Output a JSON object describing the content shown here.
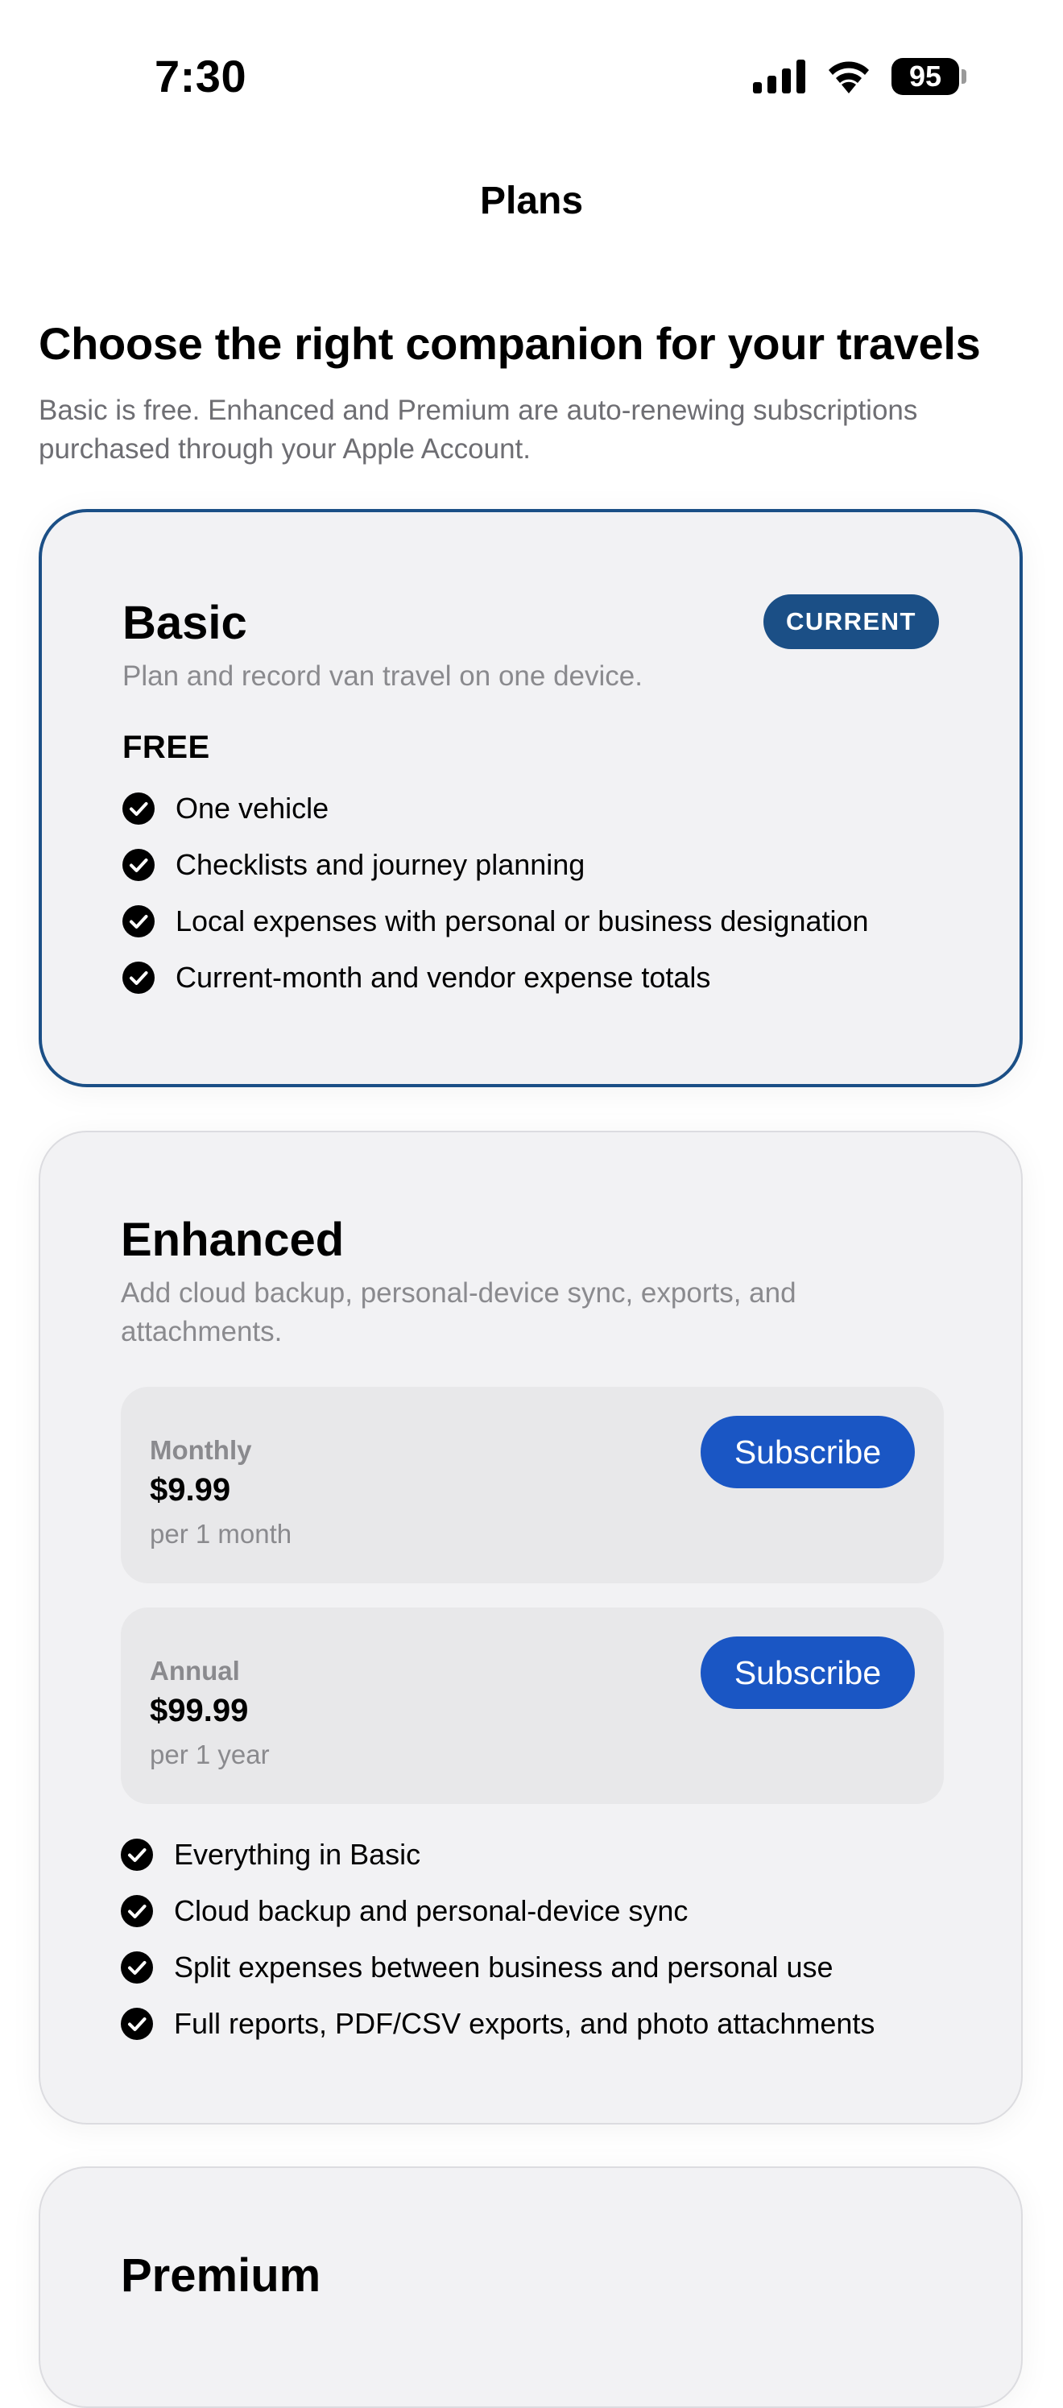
{
  "status_bar": {
    "time": "7:30",
    "battery": "95",
    "icons": [
      "cellular-signal-icon",
      "wifi-icon",
      "battery-icon"
    ]
  },
  "nav": {
    "title": "Plans"
  },
  "header": {
    "heading": "Choose the right companion for your travels",
    "subtitle": "Basic is free. Enhanced and Premium are auto-renewing subscriptions purchased through your Apple Account."
  },
  "plans": [
    {
      "name": "Basic",
      "description": "Plan and record van travel on one device.",
      "badge": "CURRENT",
      "price": "FREE",
      "features": [
        "One vehicle",
        "Checklists and journey planning",
        "Local expenses with personal or business designation",
        "Current-month and vendor expense totals"
      ]
    },
    {
      "name": "Enhanced",
      "description": "Add cloud backup, personal-device sync, exports, and attachments.",
      "options": [
        {
          "period": "Monthly",
          "price": "$9.99",
          "term": "per 1 month",
          "button": "Subscribe"
        },
        {
          "period": "Annual",
          "price": "$99.99",
          "term": "per 1 year",
          "button": "Subscribe"
        }
      ],
      "features": [
        "Everything in Basic",
        "Cloud backup and personal-device sync",
        "Split expenses between business and personal use",
        "Full reports, PDF/CSV exports, and photo attachments"
      ]
    },
    {
      "name": "Premium"
    }
  ],
  "colors": {
    "accent_navy": "#1b4f86",
    "button_blue": "#1a56c4",
    "card_background": "#f2f2f4",
    "secondary_text": "#8a8a8e"
  }
}
